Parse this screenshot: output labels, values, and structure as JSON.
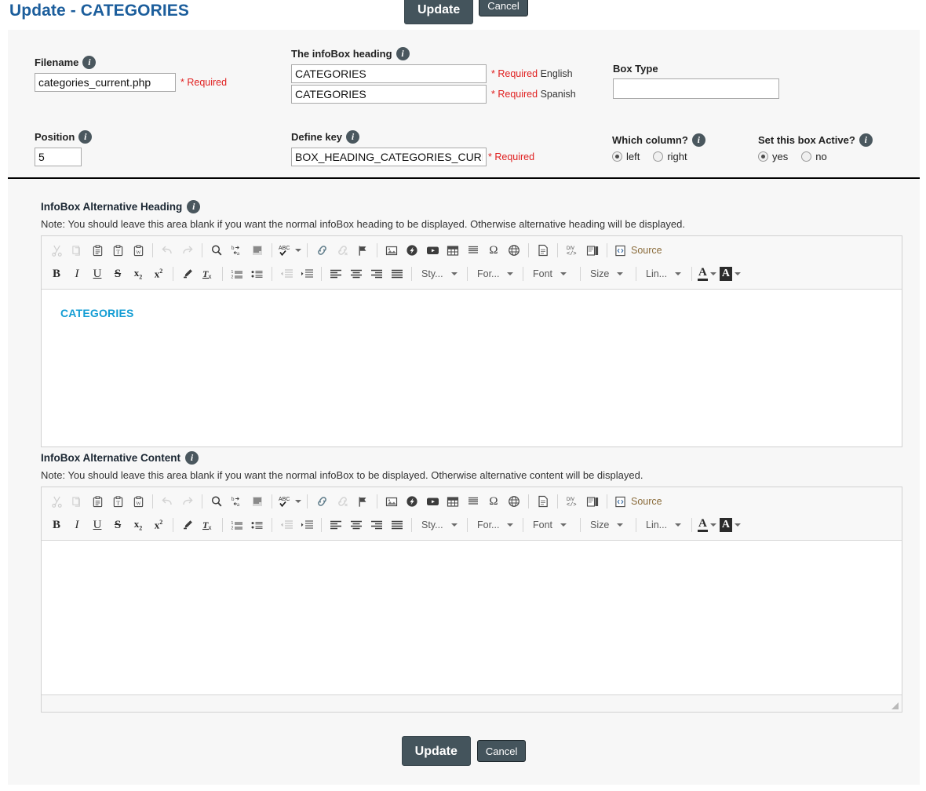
{
  "header": {
    "title": "Update - CATEGORIES",
    "update_label": "Update",
    "cancel_label": "Cancel"
  },
  "form": {
    "filename": {
      "label": "Filename",
      "value": "categories_current.php",
      "required_text": "* Required"
    },
    "infobox_heading": {
      "label": "The infoBox heading",
      "rows": [
        {
          "value": "CATEGORIES",
          "required_text": "* Required",
          "language": "English"
        },
        {
          "value": "CATEGORIES",
          "required_text": "* Required",
          "language": "Spanish"
        }
      ]
    },
    "box_type": {
      "label": "Box Type",
      "value": "",
      "placeholder": ""
    },
    "position": {
      "label": "Position",
      "value": "5"
    },
    "define_key": {
      "label": "Define key",
      "value": "BOX_HEADING_CATEGORIES_CURRENT",
      "required_text": "* Required"
    },
    "which_column": {
      "label": "Which column?",
      "options": [
        {
          "label": "left",
          "checked": true
        },
        {
          "label": "right",
          "checked": false
        }
      ]
    },
    "set_active": {
      "label": "Set this box Active?",
      "options": [
        {
          "label": "yes",
          "checked": true
        },
        {
          "label": "no",
          "checked": false
        }
      ]
    }
  },
  "sections": {
    "alt_heading": {
      "title": "InfoBox Alternative Heading",
      "note": "Note: You should leave this area blank if you want the normal infoBox heading to be displayed. Otherwise alternative heading will be displayed.",
      "content": "CATEGORIES"
    },
    "alt_content": {
      "title": "InfoBox Alternative Content",
      "note": "Note: You should leave this area blank if you want the normal infoBox to be displayed. Otherwise alternative content will be displayed.",
      "content": ""
    }
  },
  "editor_toolbar": {
    "row1": [
      "cut-icon",
      "copy-icon",
      "paste-icon",
      "paste-text-icon",
      "paste-from-word-icon",
      "sep",
      "undo-icon",
      "redo-icon",
      "sep",
      "find-icon",
      "replace-icon",
      "select-all-icon",
      "sep",
      "spell-check-icon",
      "sep",
      "link-icon",
      "unlink-icon",
      "anchor-icon",
      "sep",
      "image-icon",
      "flash-icon",
      "youtube-icon",
      "table-icon",
      "horizontal-rule-icon",
      "special-character-icon",
      "iframe-icon",
      "sep",
      "page-break-icon",
      "sep",
      "div-container-icon",
      "templates-icon",
      "sep",
      "source-button"
    ],
    "source_label": "Source",
    "dropdowns": [
      {
        "name": "styles",
        "label": "Sty..."
      },
      {
        "name": "format",
        "label": "For..."
      },
      {
        "name": "font",
        "label": "Font"
      },
      {
        "name": "size",
        "label": "Size"
      },
      {
        "name": "line-height",
        "label": "Lin..."
      }
    ],
    "text_color_glyph": "A",
    "bg_color_glyph": "A"
  },
  "footer": {
    "update_label": "Update",
    "cancel_label": "Cancel"
  },
  "colors": {
    "title_blue": "#1c5e9c",
    "button_slate": "#44545c",
    "required_red": "#e02020",
    "editor_heading_blue": "#139dd4"
  }
}
